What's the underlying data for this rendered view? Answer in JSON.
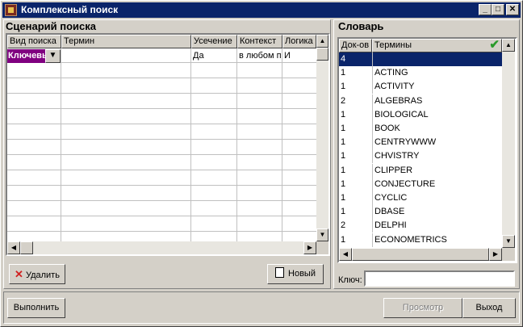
{
  "window": {
    "title": "Комплексный поиск",
    "buttons": {
      "minimize": "_",
      "maximize": "□",
      "close": "✕"
    }
  },
  "scenario": {
    "title": "Сценарий поиска",
    "columns": [
      "Вид поиска",
      "Термин",
      "Усечение",
      "Контекст",
      "Логика"
    ],
    "rows": [
      {
        "search_type": "Ключевы",
        "term": "",
        "truncation": "Да",
        "context": "в любом п",
        "logic": "И"
      }
    ],
    "delete_label": "Удалить",
    "new_label": "Новый"
  },
  "dictionary": {
    "title": "Словарь",
    "columns": [
      "Док-ов",
      "Термины"
    ],
    "rows": [
      {
        "count": "4",
        "term": ""
      },
      {
        "count": "1",
        "term": "ACTING"
      },
      {
        "count": "1",
        "term": "ACTIVITY"
      },
      {
        "count": "2",
        "term": "ALGEBRAS"
      },
      {
        "count": "1",
        "term": "BIOLOGICAL"
      },
      {
        "count": "1",
        "term": "BOOK"
      },
      {
        "count": "1",
        "term": "CENTRYWWW"
      },
      {
        "count": "1",
        "term": "CHVISTRY"
      },
      {
        "count": "1",
        "term": "CLIPPER"
      },
      {
        "count": "1",
        "term": "CONJECTURE"
      },
      {
        "count": "1",
        "term": "CYCLIC"
      },
      {
        "count": "1",
        "term": "DBASE"
      },
      {
        "count": "2",
        "term": "DELPHI"
      },
      {
        "count": "1",
        "term": "ECONOMETRICS"
      }
    ],
    "key_label": "Ключ:",
    "key_value": ""
  },
  "bottom": {
    "execute_label": "Выполнить",
    "view_label": "Просмотр",
    "exit_label": "Выход"
  },
  "colors": {
    "title_bar": "#0a246a",
    "selection": "#0a246a",
    "search_type_cell": "#800080",
    "check": "#2a9a2a"
  },
  "icons": [
    "window-app-icon",
    "dropdown-arrow-icon",
    "check-icon",
    "delete-x-icon",
    "new-document-icon"
  ]
}
